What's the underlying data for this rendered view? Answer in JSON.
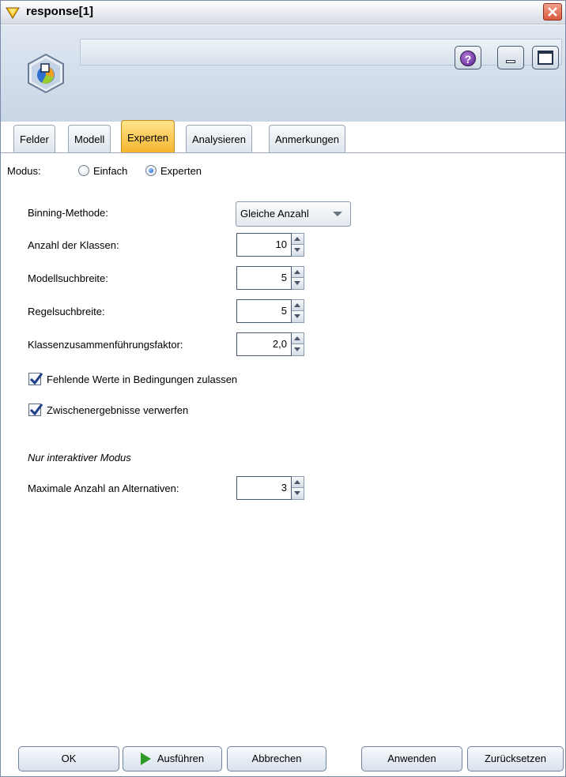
{
  "window": {
    "title": "response[1]"
  },
  "header": {
    "help_label": "?"
  },
  "tabs": [
    {
      "label": "Felder",
      "active": false
    },
    {
      "label": "Modell",
      "active": false
    },
    {
      "label": "Experten",
      "active": true
    },
    {
      "label": "Analysieren",
      "active": false
    },
    {
      "label": "Anmerkungen",
      "active": false
    }
  ],
  "mode": {
    "label": "Modus:",
    "options": [
      {
        "label": "Einfach",
        "checked": false
      },
      {
        "label": "Experten",
        "checked": true
      }
    ]
  },
  "fields": {
    "binning_method": {
      "label": "Binning-Methode:",
      "value": "Gleiche Anzahl"
    },
    "num_classes": {
      "label": "Anzahl der Klassen:",
      "value": "10"
    },
    "model_search_width": {
      "label": "Modellsuchbreite:",
      "value": "5"
    },
    "rule_search_width": {
      "label": "Regelsuchbreite:",
      "value": "5"
    },
    "class_merge_factor": {
      "label": "Klassenzusammenführungsfaktor:",
      "value": "2,0"
    }
  },
  "checkboxes": {
    "allow_missing": {
      "label": "Fehlende Werte in Bedingungen zulassen",
      "checked": true
    },
    "discard_intermediate": {
      "label": "Zwischenergebnisse verwerfen",
      "checked": true
    }
  },
  "interactive": {
    "section_title": "Nur interaktiver Modus",
    "max_alternatives": {
      "label": "Maximale Anzahl an Alternativen:",
      "value": "3"
    }
  },
  "buttons": {
    "ok": "OK",
    "run": "Ausführen",
    "cancel": "Abbrechen",
    "apply": "Anwenden",
    "reset": "Zurücksetzen"
  },
  "colors": {
    "active_tab": "#f7b42c",
    "header_bg": "#c9d6e6",
    "run_icon": "#2f9a27"
  }
}
